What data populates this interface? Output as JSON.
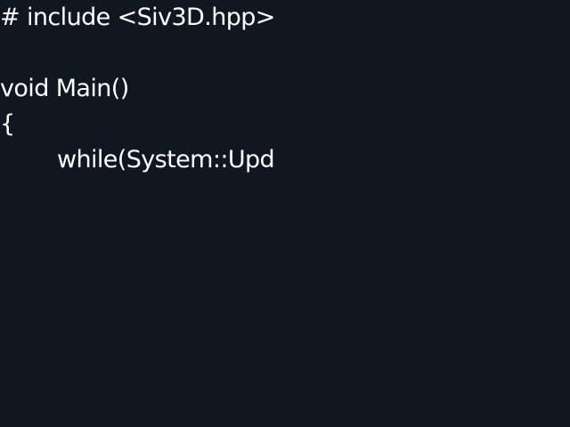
{
  "editor": {
    "background_color": "#0f1720",
    "text_color": "#ffffff",
    "lines": [
      "# include <Siv3D.hpp>",
      "",
      "void Main()",
      "{",
      "while(System::Upd"
    ]
  }
}
